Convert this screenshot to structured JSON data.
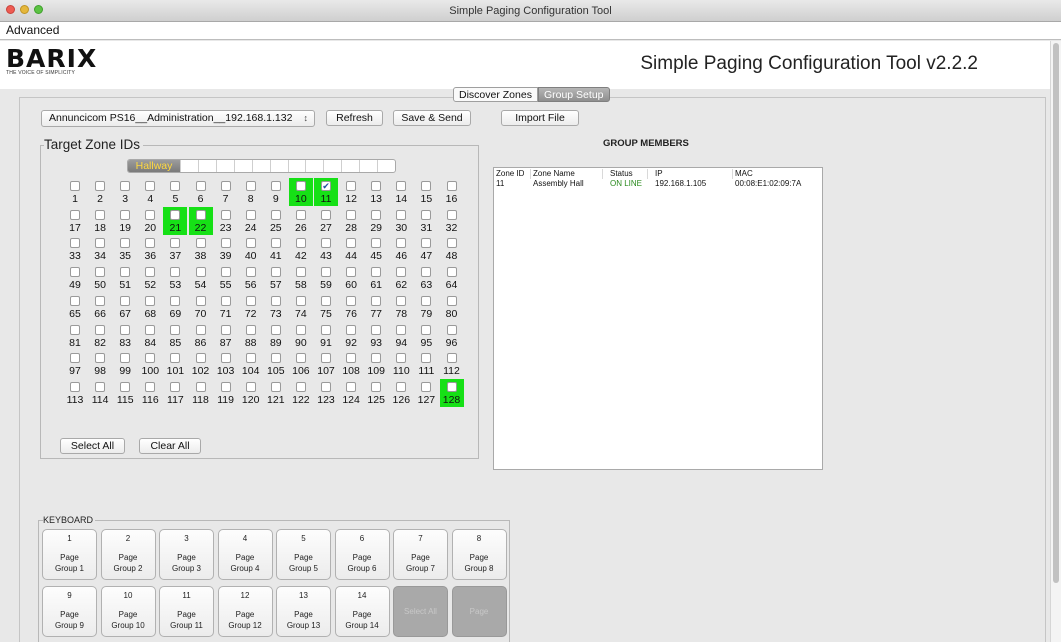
{
  "window": {
    "title": "Simple Paging Configuration Tool"
  },
  "menu": {
    "advanced": "Advanced"
  },
  "header": {
    "logo": "BARIX",
    "tagline": "THE VOICE OF SIMPLICITY",
    "app_title": "Simple Paging Configuration Tool v2.2.2"
  },
  "tabs": {
    "discover": "Discover Zones",
    "group_setup": "Group Setup",
    "active": "Group Setup"
  },
  "toolbar": {
    "device": "Annuncicom PS16__Administration__192.168.1.132",
    "refresh": "Refresh",
    "save_send": "Save & Send",
    "import": "Import File"
  },
  "zones": {
    "title": "Target Zone IDs",
    "active_tab": "Hallway",
    "count": 128,
    "active": [
      10,
      11,
      21,
      22,
      128
    ],
    "checked": [
      11
    ],
    "select_all": "Select All",
    "clear_all": "Clear All"
  },
  "group_members": {
    "title": "GROUP MEMBERS",
    "headers": [
      "Zone ID",
      "Zone Name",
      "Status",
      "IP",
      "MAC"
    ],
    "rows": [
      {
        "zone_id": "11",
        "zone_name": "Assembly Hall",
        "status": "ON LINE",
        "ip": "192.168.1.105",
        "mac": "00:08:E1:02:09:7A"
      }
    ],
    "status_color": "#2a8a1e"
  },
  "keyboard": {
    "title": "KEYBOARD",
    "keys": [
      {
        "num": "1",
        "line1": "Page",
        "line2": "Group 1"
      },
      {
        "num": "2",
        "line1": "Page",
        "line2": "Group 2"
      },
      {
        "num": "3",
        "line1": "Page",
        "line2": "Group 3"
      },
      {
        "num": "4",
        "line1": "Page",
        "line2": "Group 4"
      },
      {
        "num": "5",
        "line1": "Page",
        "line2": "Group 5"
      },
      {
        "num": "6",
        "line1": "Page",
        "line2": "Group 6"
      },
      {
        "num": "7",
        "line1": "Page",
        "line2": "Group 7"
      },
      {
        "num": "8",
        "line1": "Page",
        "line2": "Group 8"
      },
      {
        "num": "9",
        "line1": "Page",
        "line2": "Group 9"
      },
      {
        "num": "10",
        "line1": "Page",
        "line2": "Group 10"
      },
      {
        "num": "11",
        "line1": "Page",
        "line2": "Group 11"
      },
      {
        "num": "12",
        "line1": "Page",
        "line2": "Group 12"
      },
      {
        "num": "13",
        "line1": "Page",
        "line2": "Group 13"
      },
      {
        "num": "14",
        "line1": "Page",
        "line2": "Group 14"
      },
      {
        "num": "",
        "line1": "Select All",
        "line2": "",
        "disabled": true
      },
      {
        "num": "",
        "line1": "Page",
        "line2": "",
        "disabled": true
      }
    ]
  },
  "colors": {
    "zone_active": "#16e016",
    "tab_active_text": "#ffd940"
  }
}
